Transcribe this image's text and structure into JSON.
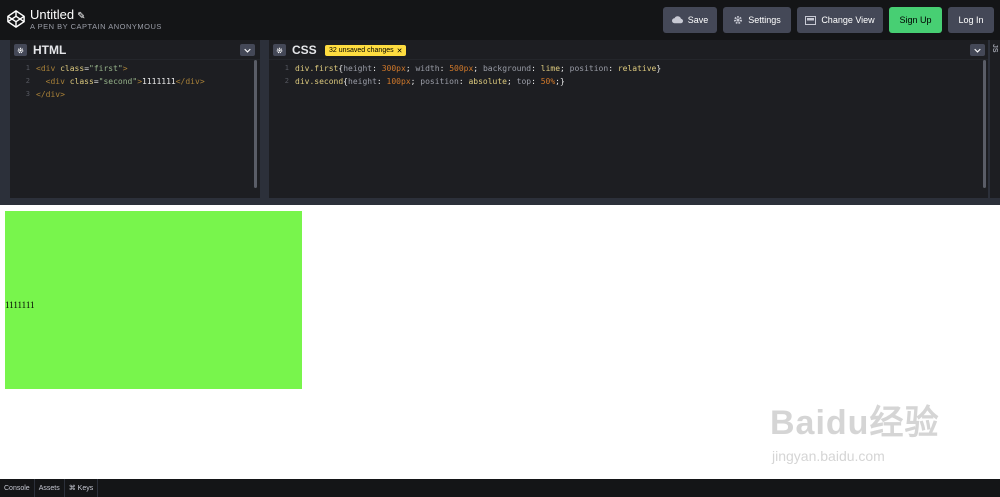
{
  "header": {
    "title": "Untitled",
    "subtitle": "A PEN BY CAPTAIN ANONYMOUS",
    "buttons": {
      "save": "Save",
      "settings": "Settings",
      "change_view": "Change View",
      "sign_up": "Sign Up",
      "log_in": "Log In"
    }
  },
  "html_pane": {
    "title": "HTML",
    "lines": [
      {
        "n": "1",
        "parts": [
          [
            "tag",
            "<div "
          ],
          [
            "attr",
            "class"
          ],
          [
            "plain",
            "="
          ],
          [
            "str",
            "\"first\""
          ],
          [
            "tag",
            ">"
          ]
        ]
      },
      {
        "n": "2",
        "parts": [
          [
            "plain",
            "  "
          ],
          [
            "tag",
            "<div "
          ],
          [
            "attr",
            "class"
          ],
          [
            "plain",
            "="
          ],
          [
            "str",
            "\"second\""
          ],
          [
            "tag",
            ">"
          ],
          [
            "plain",
            "1111111"
          ],
          [
            "tag",
            "</div>"
          ]
        ]
      },
      {
        "n": "3",
        "parts": [
          [
            "tag",
            "</div>"
          ]
        ]
      }
    ]
  },
  "css_pane": {
    "title": "CSS",
    "badge": "32 unsaved changes",
    "lines": [
      {
        "n": "1",
        "parts": [
          [
            "sel",
            "div.first"
          ],
          [
            "plain",
            "{"
          ],
          [
            "prop",
            "height"
          ],
          [
            "plain",
            ": "
          ],
          [
            "val",
            "300px"
          ],
          [
            "plain",
            "; "
          ],
          [
            "prop",
            "width"
          ],
          [
            "plain",
            ": "
          ],
          [
            "val",
            "500px"
          ],
          [
            "plain",
            "; "
          ],
          [
            "prop",
            "background"
          ],
          [
            "plain",
            ": "
          ],
          [
            "kw",
            "lime"
          ],
          [
            "plain",
            "; "
          ],
          [
            "prop",
            "position"
          ],
          [
            "plain",
            ": "
          ],
          [
            "kw",
            "relative"
          ],
          [
            "plain",
            "}"
          ]
        ]
      },
      {
        "n": "2",
        "parts": [
          [
            "sel",
            "div.second"
          ],
          [
            "plain",
            "{"
          ],
          [
            "prop",
            "height"
          ],
          [
            "plain",
            ": "
          ],
          [
            "val",
            "100px"
          ],
          [
            "plain",
            "; "
          ],
          [
            "prop",
            "position"
          ],
          [
            "plain",
            ": "
          ],
          [
            "kw",
            "absolute"
          ],
          [
            "plain",
            "; "
          ],
          [
            "prop",
            "top"
          ],
          [
            "plain",
            ": "
          ],
          [
            "val",
            "50%"
          ],
          [
            "plain",
            ";}"
          ]
        ]
      }
    ]
  },
  "js_pane": {
    "title": "JS"
  },
  "preview": {
    "second_text": "1111111",
    "first_color": "#78f54c",
    "watermark_main": "Baidu经验",
    "watermark_sub": "jingyan.baidu.com"
  },
  "footer": {
    "console": "Console",
    "assets": "Assets",
    "keys": "⌘ Keys"
  },
  "colors": {
    "header_bg": "#141517",
    "editor_bg": "#1d1e22",
    "button_bg": "#444857",
    "signup_bg": "#47cf73",
    "badge_bg": "#ffdd40"
  }
}
